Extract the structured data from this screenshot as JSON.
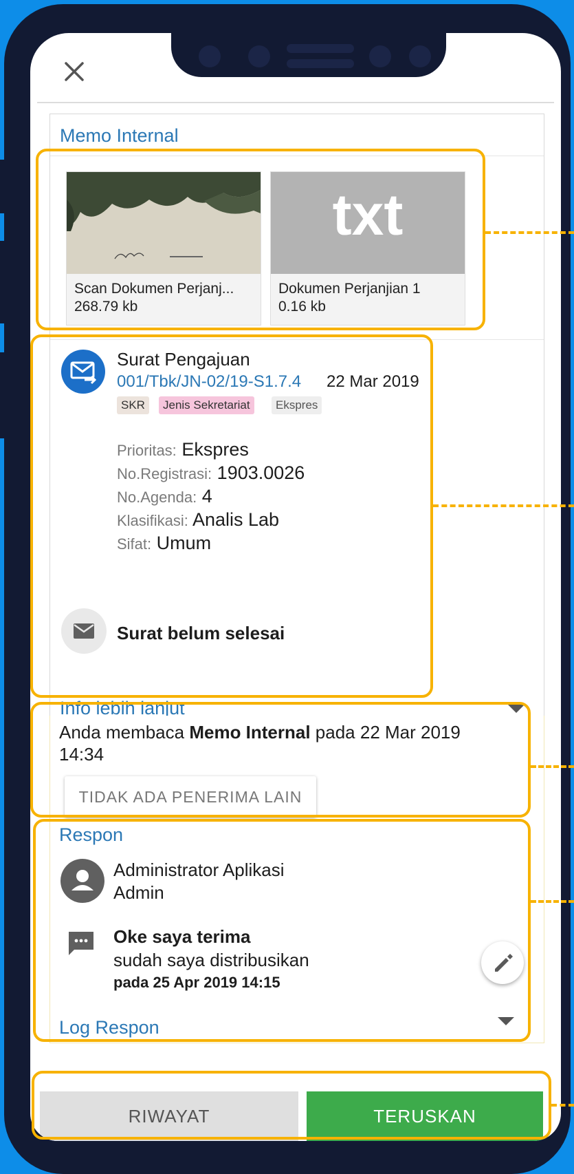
{
  "colors": {
    "accent": "#2b78b5",
    "highlight": "#f7b200",
    "primary_button": "#3dab4b",
    "background": "#0d8de8",
    "frame": "#121a33"
  },
  "header": {
    "close_icon": "close-icon"
  },
  "card": {
    "title": "Memo Internal",
    "attachments": [
      {
        "name": "Scan Dokumen Perjanj...",
        "size": "268.79 kb",
        "thumb": "photo"
      },
      {
        "name": "Dokumen Perjanjian 1",
        "size": "0.16 kb",
        "thumb": "txt"
      }
    ],
    "letter": {
      "title": "Surat Pengajuan",
      "ref": "001/Tbk/JN-02/19-S1.7.4",
      "date": "22 Mar 2019",
      "tags": [
        "SKR",
        "Jenis Sekretariat",
        "Ekspres"
      ],
      "fields": [
        {
          "label": "Prioritas:",
          "value": "Ekspres"
        },
        {
          "label": "No.Registrasi:",
          "value": "1903.0026"
        },
        {
          "label": "No.Agenda:",
          "value": "4"
        },
        {
          "label": "Klasifikasi:",
          "value": "Analis Lab"
        },
        {
          "label": "Sifat:",
          "value": "Umum"
        }
      ],
      "status": "Surat belum selesai"
    },
    "more_info": "Info lebih lanjut"
  },
  "read": {
    "prefix": "Anda membaca ",
    "doc": "Memo Internal",
    "suffix": " pada 22 Mar 2019 14:34",
    "no_recipients": "TIDAK ADA PENERIMA LAIN"
  },
  "respon": {
    "title": "Respon",
    "user_name": "Administrator Aplikasi",
    "user_role": "Admin",
    "message_title": "Oke saya terima",
    "message_body": "sudah saya distribusikan",
    "message_date": "pada 25 Apr 2019 14:15",
    "log": "Log Respon"
  },
  "actions": {
    "history": "RIWAYAT",
    "forward": "TERUSKAN"
  },
  "thumb_text": "txt"
}
